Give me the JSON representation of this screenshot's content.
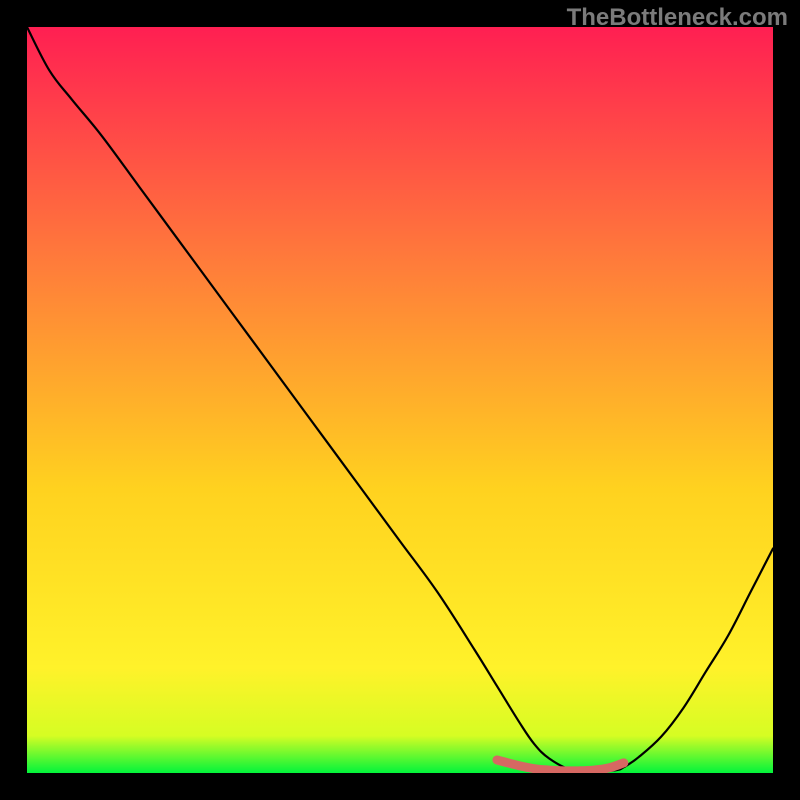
{
  "watermark": {
    "text": "TheBottleneck.com"
  },
  "colors": {
    "gradient_top": "#ff1f52",
    "gradient_mid_upper": "#ff7d3a",
    "gradient_mid": "#ffd21f",
    "gradient_mid_lower": "#fff22a",
    "gradient_bottom": "#02f43b",
    "curve": "#000000",
    "marker": "#d66862",
    "frame_bg": "#000000"
  },
  "chart_data": {
    "type": "line",
    "title": "",
    "xlabel": "",
    "ylabel": "",
    "x_range": [
      0,
      100
    ],
    "y_range": [
      0,
      103
    ],
    "series": [
      {
        "name": "bottleneck-curve",
        "x": [
          0,
          3,
          6,
          10,
          15,
          20,
          25,
          30,
          35,
          40,
          45,
          50,
          55,
          60,
          63,
          66,
          68,
          70,
          73,
          76,
          79,
          80,
          82,
          85,
          88,
          91,
          94,
          97,
          100
        ],
        "y": [
          103,
          97,
          93,
          88,
          81,
          74,
          67,
          60,
          53,
          46,
          39,
          32,
          25,
          17,
          12,
          7,
          4,
          2,
          0.4,
          0.2,
          0.4,
          0.8,
          2.2,
          5,
          9,
          14,
          19,
          25,
          31
        ]
      }
    ],
    "marker_region": {
      "name": "optimal-flat-region",
      "x": [
        63,
        66,
        68,
        70,
        72,
        74,
        76,
        78,
        80
      ],
      "y": [
        1.8,
        1.0,
        0.6,
        0.4,
        0.3,
        0.3,
        0.4,
        0.7,
        1.4
      ]
    }
  }
}
